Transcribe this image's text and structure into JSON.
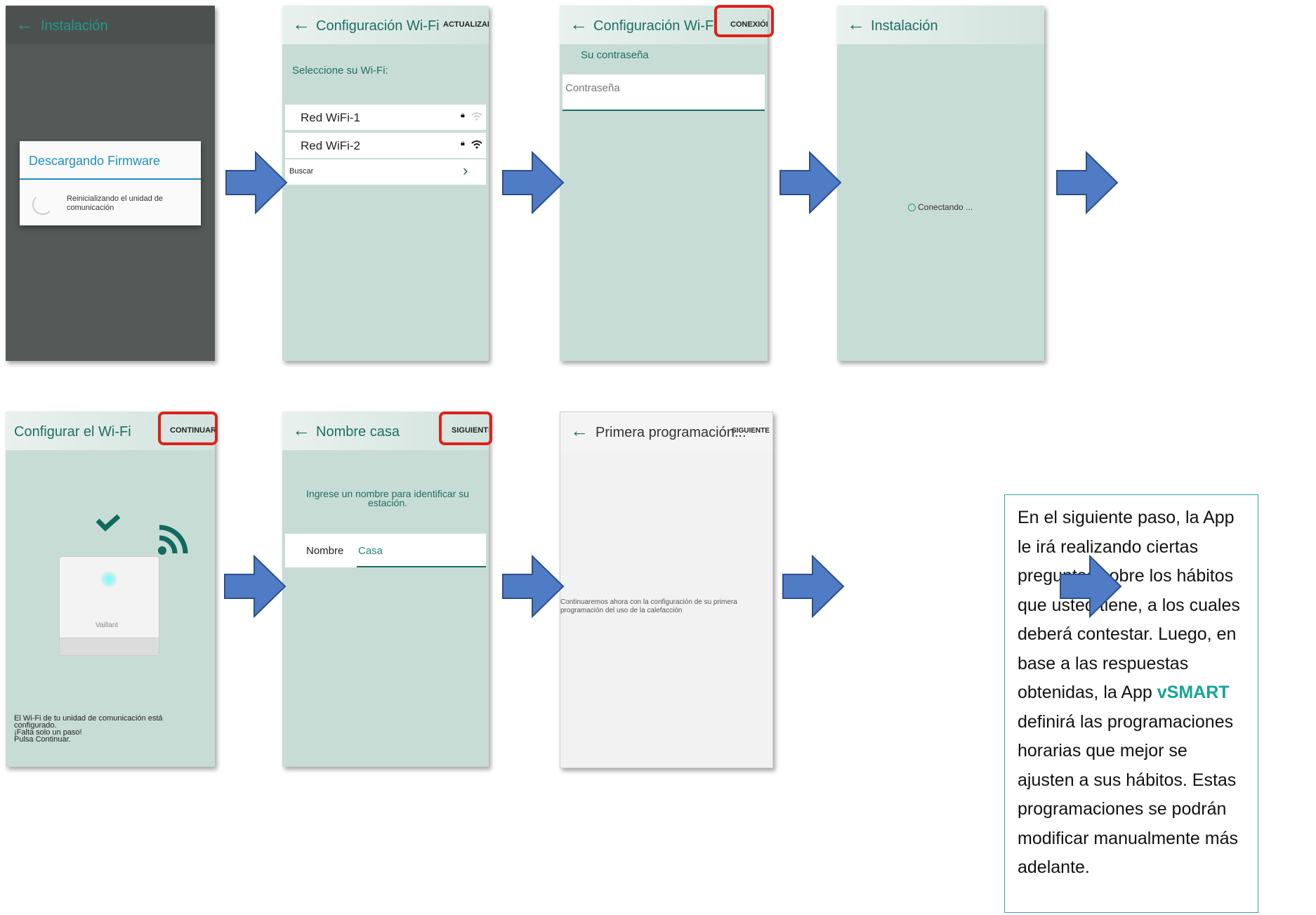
{
  "screens": [
    {
      "title": "Instalación",
      "dialog_title": "Descargando Firmware",
      "dialog_text": "Reinicializando el unidad de comunicación"
    },
    {
      "title": "Configuración Wi-Fi",
      "action": "ACTUALIZAR",
      "prompt": "Seleccione su Wi-Fi:",
      "networks": [
        {
          "name": "Red  WiFi-1"
        },
        {
          "name": "Red  WiFi-2"
        }
      ],
      "search_label": "Buscar"
    },
    {
      "title": "Configuración Wi-Fi",
      "action": "CONEXIÓN",
      "label": "Su contraseña",
      "password_placeholder": "Contraseña"
    },
    {
      "title": "Instalación",
      "status": "Conectando ..."
    },
    {
      "title": "Configurar el Wi-Fi",
      "action": "CONTINUAR",
      "brand": "Vaillant",
      "message": "El Wi-Fi de tu unidad de comunicación está configurado.\n¡Falta solo un paso!\nPulsa Continuar."
    },
    {
      "title": "Nombre casa",
      "action": "SIGUIENTE",
      "prompt": "Ingrese un nombre para identificar su estación.",
      "field_label": "Nombre",
      "field_value": "Casa"
    },
    {
      "title": "Primera programación...",
      "action": "SIGUIENTE",
      "message": "Continuaremos ahora con la configuración de su primera programación del uso de la calefacción"
    }
  ],
  "note": {
    "text_before": "En el siguiente paso, la App le irá realizando ciertas preguntas sobre los hábitos que usted tiene, a los cuales deberá contestar. Luego, en base a las respuestas obtenidas, la App ",
    "highlight": "vSMART",
    "text_after": " definirá las programaciones horarias que mejor se ajusten a sus hábitos. Estas programaciones se podrán modificar manualmente más adelante."
  },
  "colors": {
    "accent": "#1e6f62",
    "highlight_box": "#e0201a",
    "arrow_fill": "#4f7cc4",
    "screen_bg": "#c8dcd6"
  },
  "icons": [
    "back-arrow-icon",
    "lock-icon",
    "wifi-icon",
    "chevron-right-icon",
    "spinner-icon",
    "checkmark-icon",
    "wifi-signal-icon",
    "flow-arrow-icon"
  ]
}
